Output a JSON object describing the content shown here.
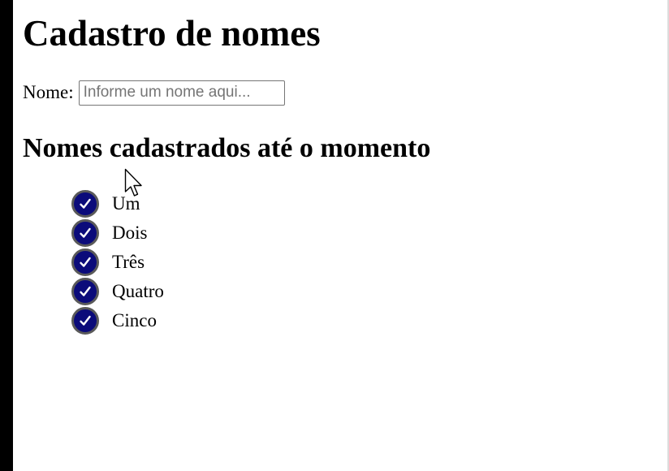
{
  "page": {
    "title": "Cadastro de nomes",
    "name_label": "Nome:",
    "name_input": {
      "placeholder": "Informe um nome aqui...",
      "value": ""
    },
    "list_heading": "Nomes cadastrados até o momento",
    "names": [
      {
        "label": "Um",
        "icon": "check-circle-icon"
      },
      {
        "label": "Dois",
        "icon": "check-circle-icon"
      },
      {
        "label": "Três",
        "icon": "check-circle-icon"
      },
      {
        "label": "Quatro",
        "icon": "check-circle-icon"
      },
      {
        "label": "Cinco",
        "icon": "check-circle-icon"
      }
    ]
  },
  "colors": {
    "check_fill": "#0b0b7a",
    "check_border": "#5a5a5a",
    "check_mark": "#ffffff",
    "text": "#000000",
    "background": "#ffffff"
  }
}
